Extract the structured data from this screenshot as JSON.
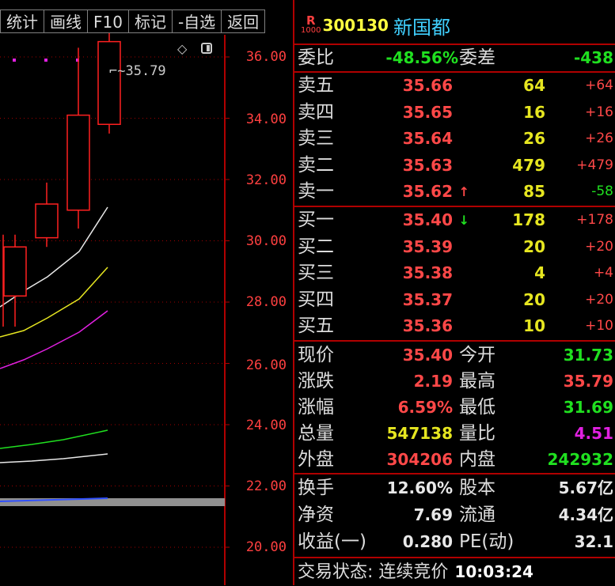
{
  "toolbar": {
    "items": [
      "统计",
      "画线",
      "F10",
      "标记",
      "-自选",
      "返回"
    ]
  },
  "chart": {
    "peak_label": "35.79",
    "price_axis": [
      "36.00",
      "34.00",
      "32.00",
      "30.00",
      "28.00",
      "26.00",
      "24.00",
      "22.00",
      "20.00"
    ]
  },
  "chart_data": {
    "type": "candlestick",
    "ylim": [
      19.5,
      37.5
    ],
    "candles": [
      {
        "open": 28.2,
        "close": 29.8,
        "high": 30.2,
        "low": 27.2
      },
      {
        "open": 30.1,
        "close": 31.2,
        "high": 31.9,
        "low": 29.8
      },
      {
        "open": 31.0,
        "close": 34.1,
        "high": 36.3,
        "low": 30.4
      },
      {
        "open": 33.8,
        "close": 36.5,
        "high": 36.9,
        "low": 33.5
      }
    ],
    "colors": {
      "up": "#ff2020",
      "ma5": "#e8e8e8",
      "ma10": "#e6e620",
      "ma20": "#e020e0",
      "grid": "#a00000",
      "axis": "#b00000"
    }
  },
  "stock": {
    "badge_top": "R",
    "badge_bottom": "1000",
    "code": "300130",
    "name": "新国都"
  },
  "weibi": {
    "label": "委比",
    "value": "-48.56%",
    "label2": "委差",
    "value2": "-438"
  },
  "sell": [
    {
      "label": "卖五",
      "price": "35.66",
      "vol": "64",
      "chg": "+64"
    },
    {
      "label": "卖四",
      "price": "35.65",
      "vol": "16",
      "chg": "+16"
    },
    {
      "label": "卖三",
      "price": "35.64",
      "vol": "26",
      "chg": "+26"
    },
    {
      "label": "卖二",
      "price": "35.63",
      "vol": "479",
      "chg": "+479"
    },
    {
      "label": "卖一",
      "price": "35.62",
      "vol": "85",
      "chg": "-58"
    }
  ],
  "buy": [
    {
      "label": "买一",
      "price": "35.40",
      "vol": "178",
      "chg": "+178"
    },
    {
      "label": "买二",
      "price": "35.39",
      "vol": "20",
      "chg": "+20"
    },
    {
      "label": "买三",
      "price": "35.38",
      "vol": "4",
      "chg": "+4"
    },
    {
      "label": "买四",
      "price": "35.37",
      "vol": "20",
      "chg": "+20"
    },
    {
      "label": "买五",
      "price": "35.36",
      "vol": "10",
      "chg": "+10"
    }
  ],
  "arrows": {
    "up": "↑",
    "down": "↓"
  },
  "quote": [
    {
      "l1": "现价",
      "v1": "35.40",
      "l2": "今开",
      "v2": "31.73"
    },
    {
      "l1": "涨跌",
      "v1": "2.19",
      "l2": "最高",
      "v2": "35.79"
    },
    {
      "l1": "涨幅",
      "v1": "6.59%",
      "l2": "最低",
      "v2": "31.69"
    },
    {
      "l1": "总量",
      "v1": "547138",
      "l2": "量比",
      "v2": "4.51"
    },
    {
      "l1": "外盘",
      "v1": "304206",
      "l2": "内盘",
      "v2": "242932"
    }
  ],
  "finance": [
    {
      "l1": "换手",
      "v1": "12.60%",
      "l2": "股本",
      "v2": "5.67亿"
    },
    {
      "l1": "净资",
      "v1": "7.69",
      "l2": "流通",
      "v2": "4.34亿"
    },
    {
      "l1": "收益(一)",
      "v1": "0.280",
      "l2": "PE(动)",
      "v2": "32.1"
    }
  ],
  "status": {
    "label": "交易状态: 连续竞价",
    "time": "10:03:24"
  }
}
